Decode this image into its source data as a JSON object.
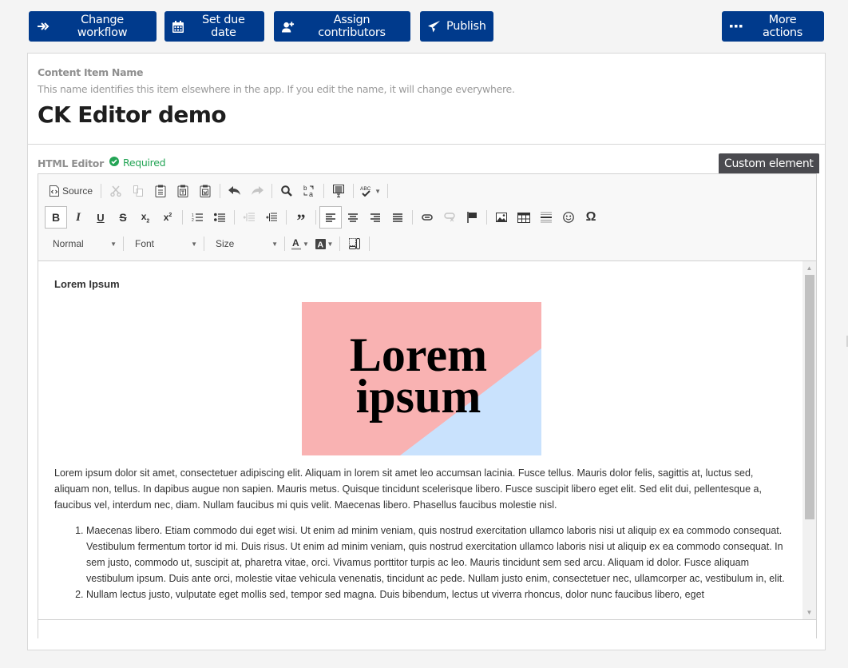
{
  "toolbar": {
    "change_workflow": "Change workflow",
    "set_due_date": "Set due date",
    "assign_contributors": "Assign contributors",
    "publish": "Publish",
    "more_actions": "More actions"
  },
  "name_field": {
    "label": "Content Item Name",
    "hint": "This name identifies this item elsewhere in the app. If you edit the name, it will change everywhere.",
    "value": "CK Editor demo"
  },
  "html_field": {
    "label": "HTML Editor",
    "required_label": "Required",
    "tooltip": "Custom element"
  },
  "editor_toolbar": {
    "source_label": "Source",
    "format_value": "Normal",
    "font_value": "Font",
    "size_value": "Size",
    "icons_row1": [
      "source-icon",
      "cut-icon",
      "copy-icon",
      "paste-icon",
      "paste-text-icon",
      "paste-word-icon",
      "undo-icon",
      "redo-icon",
      "find-icon",
      "replace-icon",
      "select-all-icon",
      "spellcheck-icon"
    ],
    "icons_row2": [
      "bold-icon",
      "italic-icon",
      "underline-icon",
      "strikethrough-icon",
      "subscript-icon",
      "superscript-icon",
      "numbered-list-icon",
      "bulleted-list-icon",
      "outdent-icon",
      "indent-icon",
      "blockquote-icon",
      "align-left-icon",
      "align-center-icon",
      "align-right-icon",
      "justify-icon",
      "link-icon",
      "unlink-icon",
      "anchor-icon",
      "image-icon",
      "table-icon",
      "horizontal-line-icon",
      "smiley-icon",
      "special-char-icon"
    ],
    "icons_row3": [
      "text-color-icon",
      "background-color-icon",
      "show-blocks-icon"
    ]
  },
  "content": {
    "heading": "Lorem Ipsum",
    "image_text_line1": "Lorem",
    "image_text_line2": "ipsum",
    "image_colors": {
      "pink": "#f9b2b2",
      "blue": "#c9e2fd"
    },
    "paragraph": "Lorem ipsum dolor sit amet, consectetuer adipiscing elit. Aliquam in lorem sit amet leo accumsan lacinia. Fusce tellus. Mauris dolor felis, sagittis at, luctus sed, aliquam non, tellus. In dapibus augue non sapien. Mauris metus. Quisque tincidunt scelerisque libero. Fusce suscipit libero eget elit. Sed elit dui, pellentesque a, faucibus vel, interdum nec, diam. Nullam faucibus mi quis velit. Maecenas libero. Phasellus faucibus molestie nisl.",
    "list_items": [
      "Maecenas libero. Etiam commodo dui eget wisi. Ut enim ad minim veniam, quis nostrud exercitation ullamco laboris nisi ut aliquip ex ea commodo consequat. Vestibulum fermentum tortor id mi. Duis risus. Ut enim ad minim veniam, quis nostrud exercitation ullamco laboris nisi ut aliquip ex ea commodo consequat. In sem justo, commodo ut, suscipit at, pharetra vitae, orci. Vivamus porttitor turpis ac leo. Mauris tincidunt sem sed arcu. Aliquam id dolor. Fusce aliquam vestibulum ipsum. Duis ante orci, molestie vitae vehicula venenatis, tincidunt ac pede. Nullam justo enim, consectetuer nec, ullamcorper ac, vestibulum in, elit.",
      "Nullam lectus justo, vulputate eget mollis sed, tempor sed magna. Duis bibendum, lectus ut viverra rhoncus, dolor nunc faucibus libero, eget"
    ]
  },
  "colors": {
    "primary": "#003a8c",
    "required_green": "#23a455",
    "tooltip_bg": "#4a4a4f"
  }
}
